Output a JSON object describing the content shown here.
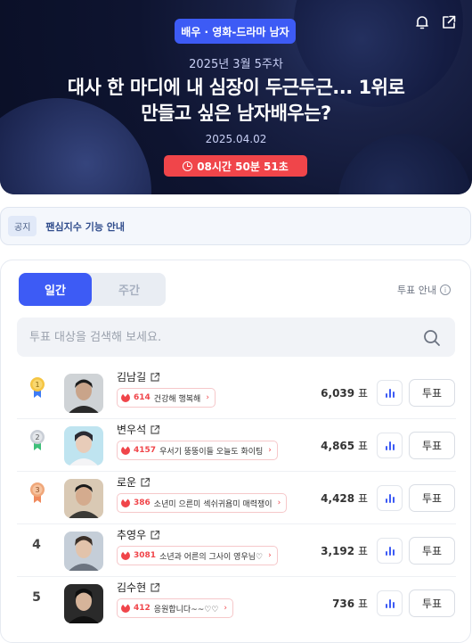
{
  "banner": {
    "category": "배우 · 영화-드라마 남자",
    "week": "2025년 3월 5주차",
    "title_line1": "대사 한 마디에 내 심장이 두근두근... 1위로",
    "title_line2": "만들고 싶은 남자배우는?",
    "date": "2025.04.02",
    "timer": "08시간 50분 51초",
    "icons": [
      "bell-icon",
      "share-icon"
    ]
  },
  "notice": {
    "tag": "공지",
    "text": "팬심지수 기능 안내"
  },
  "tabs": {
    "daily": "일간",
    "weekly": "주간",
    "active": "daily"
  },
  "guide": {
    "label": "투표 안내",
    "icon": "info-icon"
  },
  "search": {
    "placeholder": "투표 대상을 검색해 보세요.",
    "value": ""
  },
  "rows": [
    {
      "rank": "1",
      "medal": "gold",
      "name": "김남길",
      "cheer_count": "614",
      "cheer_text": "건강해 행복해",
      "votes": "6,039",
      "unit": "표",
      "vote_label": "투표"
    },
    {
      "rank": "2",
      "medal": "silver",
      "name": "변우석",
      "cheer_count": "4157",
      "cheer_text": "우서기 뚱뚱이들 오늘도 화이팅",
      "votes": "4,865",
      "unit": "표",
      "vote_label": "투표"
    },
    {
      "rank": "3",
      "medal": "bronze",
      "name": "로운",
      "cheer_count": "386",
      "cheer_text": "소년미 으른미 섹쉬귀욤미 매력쟁이",
      "votes": "4,428",
      "unit": "표",
      "vote_label": "투표"
    },
    {
      "rank": "4",
      "medal": "",
      "name": "추영우",
      "cheer_count": "3081",
      "cheer_text": "소년과 어른의 그사이 영우님♡",
      "votes": "3,192",
      "unit": "표",
      "vote_label": "투표"
    },
    {
      "rank": "5",
      "medal": "",
      "name": "김수현",
      "cheer_count": "412",
      "cheer_text": "응원합니다~~♡♡",
      "votes": "736",
      "unit": "표",
      "vote_label": "투표"
    }
  ],
  "colors": {
    "accent": "#3d5bf5",
    "timer_red": "#f0454a",
    "gold": "#f5c542",
    "silver": "#c9ced6",
    "bronze": "#f0a77a"
  }
}
